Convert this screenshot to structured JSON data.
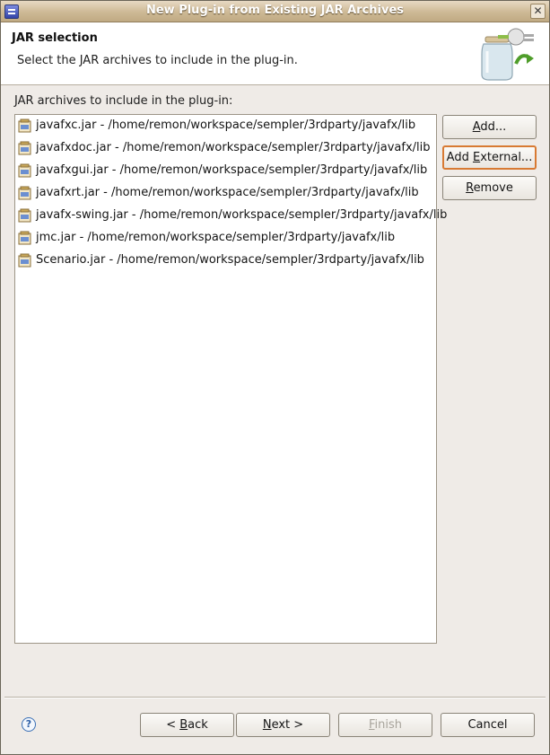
{
  "window": {
    "title": "New Plug-in from Existing JAR Archives",
    "close_glyph": "✕"
  },
  "header": {
    "title": "JAR selection",
    "description": "Select the JAR archives to include in the plug-in."
  },
  "section_label": "JAR archives to include in the plug-in:",
  "jars": [
    {
      "label": "javafxc.jar - /home/remon/workspace/sempler/3rdparty/javafx/lib"
    },
    {
      "label": "javafxdoc.jar - /home/remon/workspace/sempler/3rdparty/javafx/lib"
    },
    {
      "label": "javafxgui.jar - /home/remon/workspace/sempler/3rdparty/javafx/lib"
    },
    {
      "label": "javafxrt.jar - /home/remon/workspace/sempler/3rdparty/javafx/lib"
    },
    {
      "label": "javafx-swing.jar - /home/remon/workspace/sempler/3rdparty/javafx/lib"
    },
    {
      "label": "jmc.jar - /home/remon/workspace/sempler/3rdparty/javafx/lib"
    },
    {
      "label": "Scenario.jar - /home/remon/workspace/sempler/3rdparty/javafx/lib"
    }
  ],
  "side_buttons": {
    "add": {
      "mnemonic": "A",
      "rest": "dd..."
    },
    "add_external": {
      "pre": "Add ",
      "mnemonic": "E",
      "rest": "xternal..."
    },
    "remove": {
      "mnemonic": "R",
      "rest": "emove"
    }
  },
  "footer": {
    "help_glyph": "?",
    "back": {
      "pre": "< ",
      "mnemonic": "B",
      "rest": "ack"
    },
    "next": {
      "mnemonic": "N",
      "rest": "ext >"
    },
    "finish": {
      "mnemonic": "F",
      "rest": "inish"
    },
    "cancel": "Cancel"
  },
  "icons": {
    "app": "eclipse-app-icon",
    "jar": "jar-file-icon",
    "wizard": "plugin-jar-wizard-icon",
    "help": "help-icon"
  },
  "colors": {
    "titlebar": "#cdb995",
    "dialog_bg": "#efebe7",
    "focus_border": "#d87a33"
  }
}
